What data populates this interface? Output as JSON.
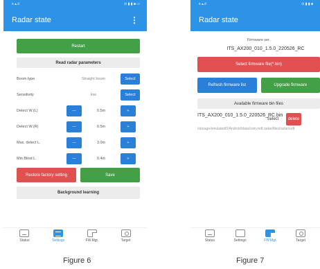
{
  "colors": {
    "header": "#2d93e6",
    "green": "#43a047",
    "red": "#e05050",
    "blue": "#2a80d8"
  },
  "fig6": {
    "title": "Radar state",
    "restart": "Restart",
    "read_params": "Read radar parameters",
    "boom": {
      "label": "Boom type",
      "value": "Straight boom",
      "button": "Select"
    },
    "sensitivity": {
      "label": "Sensitivity",
      "value": "low",
      "button": "Select"
    },
    "rows": [
      {
        "label": "Detect W.(L)",
        "minus": "—",
        "value": "0.5m",
        "plus": "+"
      },
      {
        "label": "Detect W.(R)",
        "minus": "—",
        "value": "0.5m",
        "plus": "+"
      },
      {
        "label": "Max. detect L.",
        "minus": "—",
        "value": "3.0m",
        "plus": "+"
      },
      {
        "label": "Min.Blind L.",
        "minus": "—",
        "value": "0.4m",
        "plus": "+"
      }
    ],
    "restore": "Restore factory setting",
    "save": "Save",
    "background": "Background learning",
    "caption": "Figure 6"
  },
  "fig7": {
    "title": "Radar state",
    "fw_label": "Firmware ver.",
    "fw_version": "ITS_AX200_010_1.5.0_220526_RC",
    "select_file": "Select firmware file(*.bin)",
    "refresh": "Refresh firmware list",
    "upgrade": "Upgrade firmware",
    "available": "Available firmware bin files",
    "file_name": "ITS_AX200_010_1.5.0_220526_RC.bin",
    "file_path": "/storage/emulated/0/Android/data/com.mdt.radar/files/radar/soft",
    "file_select": "Select",
    "file_delete": "delete",
    "caption": "Figure 7"
  },
  "tabs": [
    "Status",
    "Settings",
    "FW.Mgt.",
    "Target"
  ]
}
